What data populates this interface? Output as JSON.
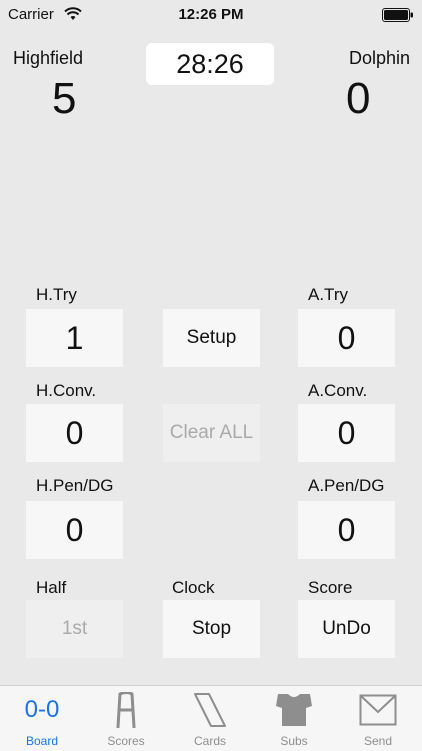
{
  "status_bar": {
    "carrier": "Carrier",
    "time": "12:26 PM"
  },
  "header": {
    "home_team": "Highfield",
    "away_team": "Dolphin",
    "home_score": "5",
    "away_score": "0",
    "clock": "28:26"
  },
  "board": {
    "h_try_label": "H.Try",
    "h_try_value": "1",
    "a_try_label": "A.Try",
    "a_try_value": "0",
    "h_conv_label": "H.Conv.",
    "h_conv_value": "0",
    "a_conv_label": "A.Conv.",
    "a_conv_value": "0",
    "h_pen_label": "H.Pen/DG",
    "h_pen_value": "0",
    "a_pen_label": "A.Pen/DG",
    "a_pen_value": "0",
    "setup_label": "Setup",
    "clear_all_label": "Clear ALL",
    "half_label": "Half",
    "half_value": "1st",
    "clock_label": "Clock",
    "clock_button": "Stop",
    "score_label": "Score",
    "score_button": "UnDo"
  },
  "tabs": [
    {
      "label": "Board",
      "icon": "0-0",
      "active": true
    },
    {
      "label": "Scores",
      "icon": "goalposts-icon"
    },
    {
      "label": "Cards",
      "icon": "card-icon"
    },
    {
      "label": "Subs",
      "icon": "shirt-icon"
    },
    {
      "label": "Send",
      "icon": "envelope-icon"
    }
  ],
  "colors": {
    "accent": "#1a73e8",
    "background": "#e9e9e9",
    "tile": "#f7f7f7"
  }
}
